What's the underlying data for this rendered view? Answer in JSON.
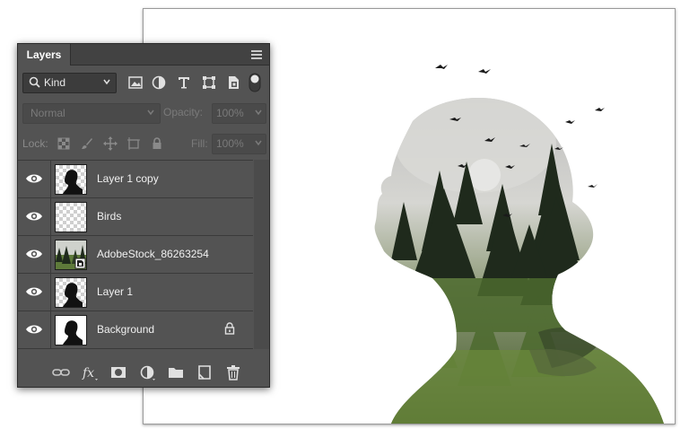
{
  "panel": {
    "tab_label": "Layers",
    "menu_icon": "panel-menu-icon"
  },
  "filter": {
    "kind_label": "Kind",
    "icons": [
      "pixel-layer-filter-icon",
      "adjustment-layer-filter-icon",
      "type-layer-filter-icon",
      "shape-layer-filter-icon",
      "smart-object-filter-icon",
      "filter-toggle-icon"
    ]
  },
  "blend": {
    "mode": "Normal",
    "opacity_label": "Opacity:",
    "opacity_value": "100%"
  },
  "lock": {
    "label": "Lock:",
    "fill_label": "Fill:",
    "fill_value": "100%"
  },
  "layers": [
    {
      "name": "Layer 1 copy",
      "visible": true,
      "thumb": "silhouette-transparent"
    },
    {
      "name": "Birds",
      "visible": true,
      "thumb": "transparent"
    },
    {
      "name": "AdobeStock_86263254",
      "visible": true,
      "thumb": "forest-smart-object"
    },
    {
      "name": "Layer 1",
      "visible": true,
      "thumb": "silhouette-transparent"
    },
    {
      "name": "Background",
      "visible": true,
      "thumb": "silhouette-white",
      "locked": true
    }
  ],
  "footer_icons": [
    "link-layers-icon",
    "fx-icon",
    "layer-mask-icon",
    "adjustment-layer-icon",
    "new-group-icon",
    "new-layer-icon",
    "trash-icon"
  ],
  "colors": {
    "panel_bg": "#535353",
    "tab_bar": "#424242",
    "canvas_bg": "#ffffff",
    "forest_dark": "#1f2a1c",
    "forest_green": "#5e7a3a"
  }
}
